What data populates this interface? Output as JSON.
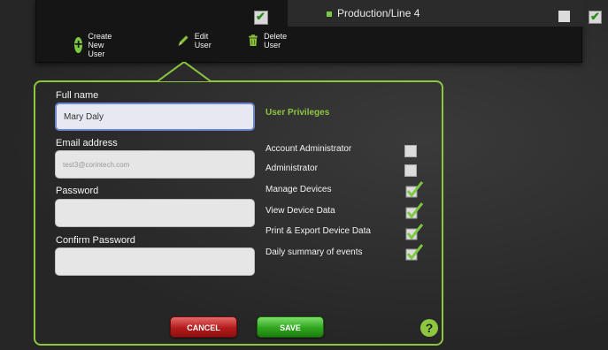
{
  "top_panel": {
    "production_row_label": "Production/Line 4"
  },
  "toolbar": {
    "create_label": "Create New User",
    "edit_label": "Edit User",
    "delete_label": "Delete User"
  },
  "form": {
    "full_name_label": "Full name",
    "full_name_value": "Mary Daly",
    "email_label": "Email address",
    "email_value": "test3@corintech.com",
    "password_label": "Password",
    "password_value": "",
    "confirm_label": "Confirm Password",
    "confirm_value": ""
  },
  "privileges": {
    "title": "User Privileges",
    "items": [
      {
        "label": "Account Administrator",
        "checked": false
      },
      {
        "label": "Administrator",
        "checked": false
      },
      {
        "label": "Manage Devices",
        "checked": true
      },
      {
        "label": "View Device Data",
        "checked": true
      },
      {
        "label": "Print & Export Device Data",
        "checked": true
      },
      {
        "label": "Daily summary of events",
        "checked": true
      }
    ]
  },
  "buttons": {
    "cancel_label": "CANCEL",
    "save_label": "SAVE",
    "help_label": "?"
  },
  "colors": {
    "accent_green": "#8dc63f",
    "cancel_red": "#b31b1b",
    "save_green": "#2fa51e"
  },
  "icons": {
    "create": "plus-circle-icon",
    "edit": "pencil-icon",
    "delete": "trash-icon",
    "help": "question-icon"
  }
}
